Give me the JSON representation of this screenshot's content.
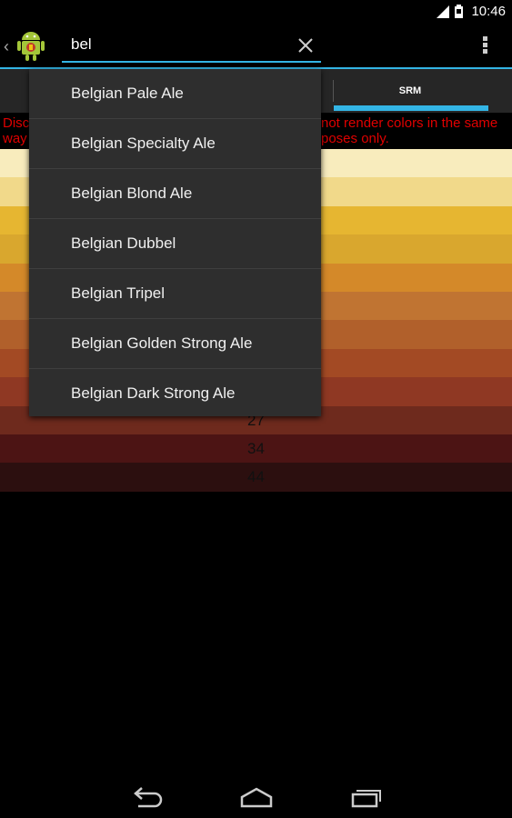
{
  "status_bar": {
    "time": "10:46"
  },
  "action_bar": {
    "search_value": "bel",
    "clear_icon": "close-icon",
    "overflow_icon": "overflow-menu-icon"
  },
  "tabs": {
    "srm_label": "SRM"
  },
  "disclaimer": {
    "line1_left": "Disc",
    "line1_right": "not render colors in the same",
    "line2_left": "way",
    "line2_right": "poses only."
  },
  "srm_rows": [
    {
      "label": "",
      "color": "#f8ecbd"
    },
    {
      "label": "",
      "color": "#f1d98a"
    },
    {
      "label": "",
      "color": "#e6b631"
    },
    {
      "label": "",
      "color": "#d9a72e"
    },
    {
      "label": "",
      "color": "#d48929"
    },
    {
      "label": "",
      "color": "#c07432"
    },
    {
      "label": "",
      "color": "#b1602b"
    },
    {
      "label": "",
      "color": "#a34a24"
    },
    {
      "label": "",
      "color": "#8f3823"
    },
    {
      "label": "27",
      "color": "#6e2a1d"
    },
    {
      "label": "34",
      "color": "#4c1414"
    },
    {
      "label": "44",
      "color": "#2c0f0f"
    }
  ],
  "suggestions": [
    "Belgian Pale Ale",
    "Belgian Specialty Ale",
    "Belgian Blond Ale",
    "Belgian Dubbel",
    "Belgian Tripel",
    "Belgian Golden Strong Ale",
    "Belgian Dark Strong Ale"
  ],
  "nav_bar": {
    "back_icon": "back-icon",
    "home_icon": "home-icon",
    "recents_icon": "recents-icon"
  },
  "colors": {
    "accent": "#33b5e5",
    "warning": "#e00000"
  }
}
